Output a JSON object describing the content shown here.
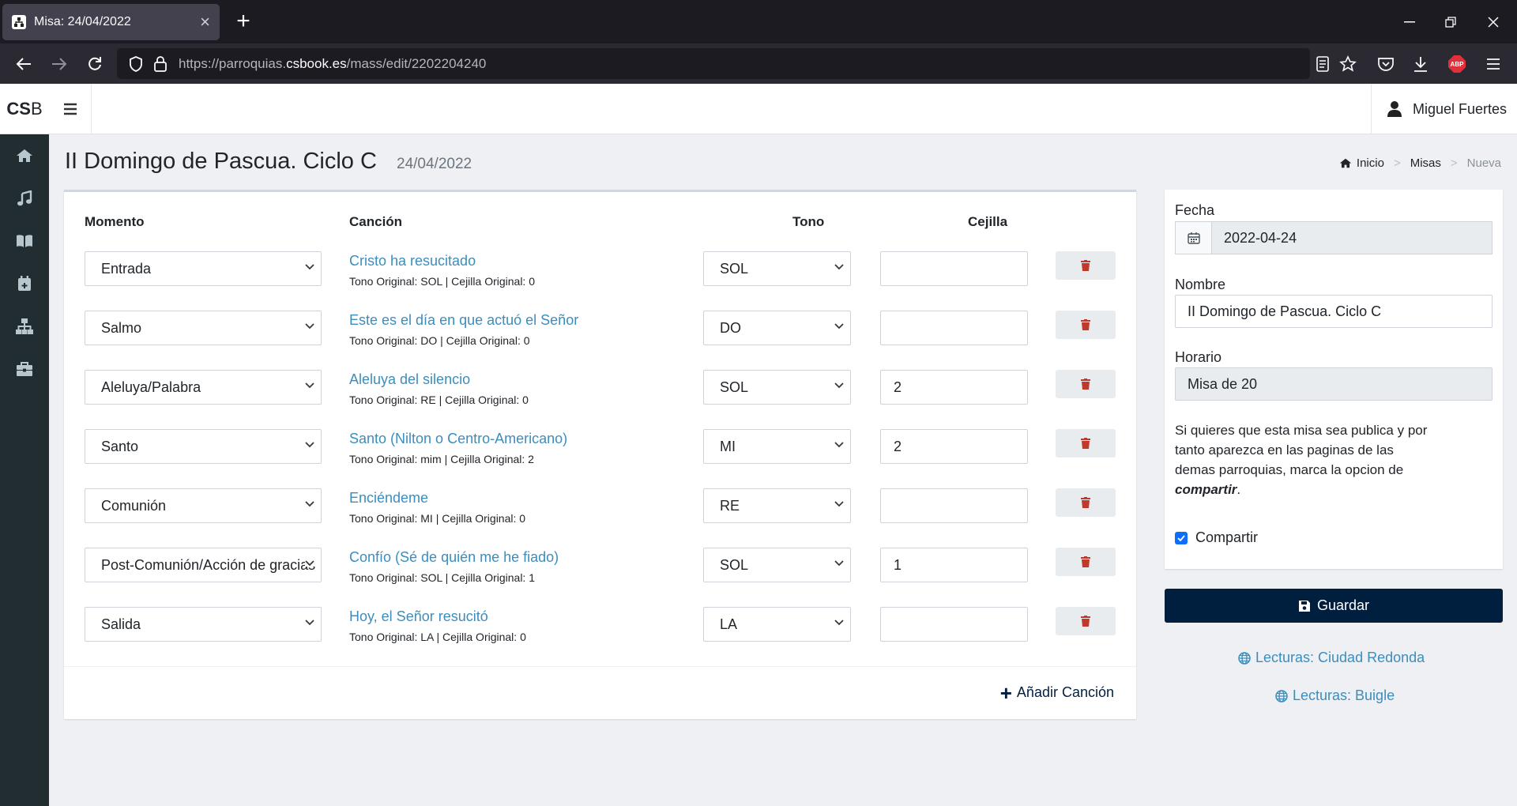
{
  "browser": {
    "tab_title": "Misa: 24/04/2022",
    "url_prefix": "https://parroquias.",
    "url_host": "csbook.es",
    "url_path": "/mass/edit/2202204240"
  },
  "app": {
    "brand_bold": "CS",
    "brand_rest": "B",
    "user_name": "Miguel Fuertes",
    "sidebar_icons": [
      "home-icon",
      "music-icon",
      "book-icon",
      "calendar-plus-icon",
      "sitemap-icon",
      "toolbox-icon"
    ]
  },
  "page": {
    "title": "II Domingo de Pascua. Ciclo C",
    "date": "24/04/2022",
    "breadcrumb": [
      "Inicio",
      "Misas",
      "Nueva"
    ]
  },
  "songs_table": {
    "headers": {
      "momento": "Momento",
      "cancion": "Canción",
      "tono": "Tono",
      "cejilla": "Cejilla"
    },
    "rows": [
      {
        "momento": "Entrada",
        "song": "Cristo ha resucitado",
        "meta": "Tono Original: SOL | Cejilla Original: 0",
        "tono": "SOL",
        "cejilla": ""
      },
      {
        "momento": "Salmo",
        "song": "Este es el día en que actuó el Señor",
        "meta": "Tono Original: DO | Cejilla Original: 0",
        "tono": "DO",
        "cejilla": ""
      },
      {
        "momento": "Aleluya/Palabra",
        "song": "Aleluya del silencio",
        "meta": "Tono Original: RE | Cejilla Original: 0",
        "tono": "SOL",
        "cejilla": "2"
      },
      {
        "momento": "Santo",
        "song": "Santo (Nilton o Centro-Americano)",
        "meta": "Tono Original: mim | Cejilla Original: 2",
        "tono": "MI",
        "cejilla": "2"
      },
      {
        "momento": "Comunión",
        "song": "Enciéndeme",
        "meta": "Tono Original: MI | Cejilla Original: 0",
        "tono": "RE",
        "cejilla": ""
      },
      {
        "momento": "Post-Comunión/Acción de gracias",
        "song": "Confío (Sé de quién me he fiado)",
        "meta": "Tono Original: SOL | Cejilla Original: 1",
        "tono": "SOL",
        "cejilla": "1"
      },
      {
        "momento": "Salida",
        "song": "Hoy, el Señor resucitó",
        "meta": "Tono Original: LA | Cejilla Original: 0",
        "tono": "LA",
        "cejilla": ""
      }
    ],
    "add_label": "Añadir Canción"
  },
  "form": {
    "fecha_label": "Fecha",
    "fecha_value": "2022-04-24",
    "nombre_label": "Nombre",
    "nombre_value": "II Domingo de Pascua. Ciclo C",
    "horario_label": "Horario",
    "horario_value": "Misa de 20",
    "help_text": "Si quieres que esta misa sea publica y por tanto aparezca en las paginas de las demas parroquias, marca la opcion de",
    "help_bold": "compartir",
    "help_end": ".",
    "share_label": "Compartir",
    "share_checked": true,
    "save_label": "Guardar",
    "reading1": "Lecturas: Ciudad Redonda",
    "reading2": "Lecturas: Buigle"
  },
  "colors": {
    "accent": "#001f3f",
    "link": "#3c8dbc",
    "danger": "#c0392b",
    "sidebar": "#222d32"
  }
}
